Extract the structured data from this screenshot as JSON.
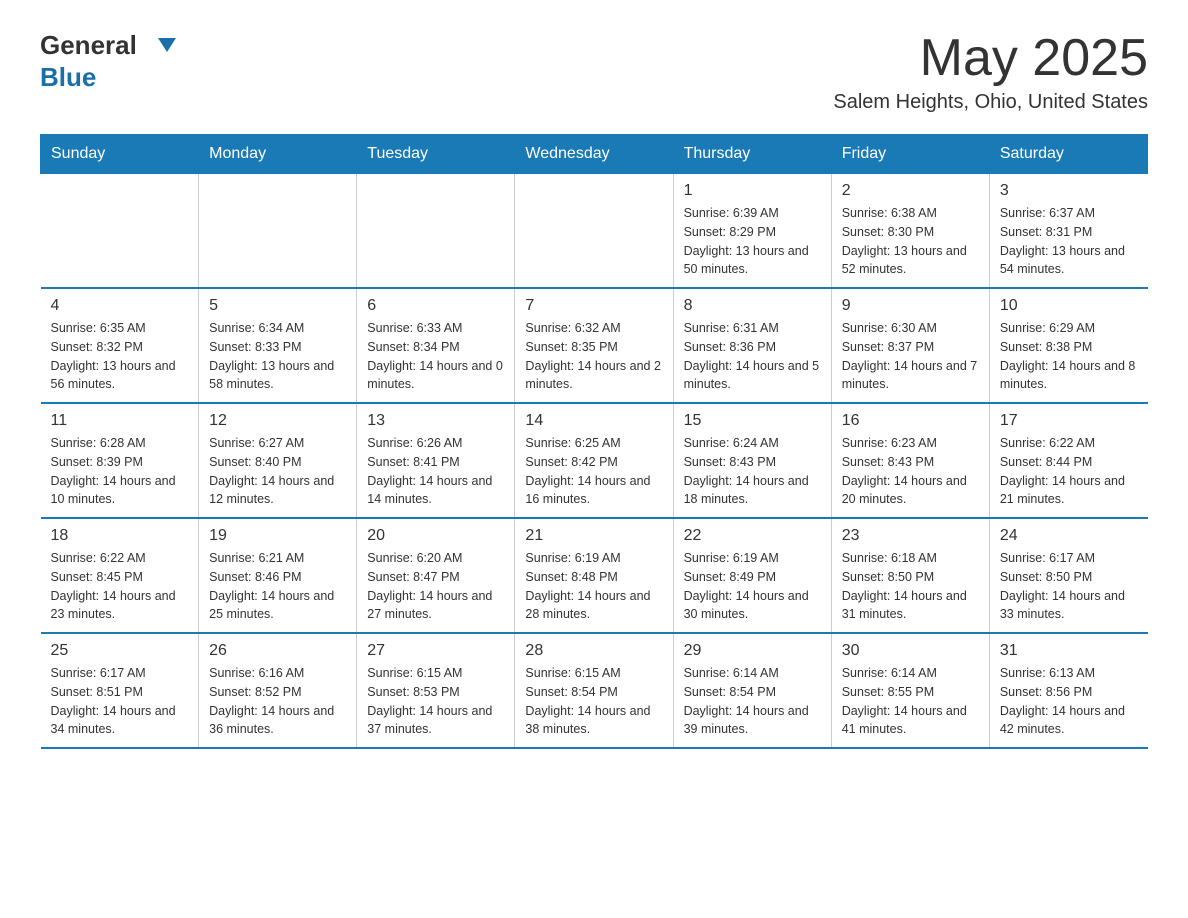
{
  "header": {
    "logo_general": "General",
    "logo_blue": "Blue",
    "month_title": "May 2025",
    "location": "Salem Heights, Ohio, United States"
  },
  "weekdays": [
    "Sunday",
    "Monday",
    "Tuesday",
    "Wednesday",
    "Thursday",
    "Friday",
    "Saturday"
  ],
  "weeks": [
    [
      {
        "day": "",
        "info": ""
      },
      {
        "day": "",
        "info": ""
      },
      {
        "day": "",
        "info": ""
      },
      {
        "day": "",
        "info": ""
      },
      {
        "day": "1",
        "info": "Sunrise: 6:39 AM\nSunset: 8:29 PM\nDaylight: 13 hours and 50 minutes."
      },
      {
        "day": "2",
        "info": "Sunrise: 6:38 AM\nSunset: 8:30 PM\nDaylight: 13 hours and 52 minutes."
      },
      {
        "day": "3",
        "info": "Sunrise: 6:37 AM\nSunset: 8:31 PM\nDaylight: 13 hours and 54 minutes."
      }
    ],
    [
      {
        "day": "4",
        "info": "Sunrise: 6:35 AM\nSunset: 8:32 PM\nDaylight: 13 hours and 56 minutes."
      },
      {
        "day": "5",
        "info": "Sunrise: 6:34 AM\nSunset: 8:33 PM\nDaylight: 13 hours and 58 minutes."
      },
      {
        "day": "6",
        "info": "Sunrise: 6:33 AM\nSunset: 8:34 PM\nDaylight: 14 hours and 0 minutes."
      },
      {
        "day": "7",
        "info": "Sunrise: 6:32 AM\nSunset: 8:35 PM\nDaylight: 14 hours and 2 minutes."
      },
      {
        "day": "8",
        "info": "Sunrise: 6:31 AM\nSunset: 8:36 PM\nDaylight: 14 hours and 5 minutes."
      },
      {
        "day": "9",
        "info": "Sunrise: 6:30 AM\nSunset: 8:37 PM\nDaylight: 14 hours and 7 minutes."
      },
      {
        "day": "10",
        "info": "Sunrise: 6:29 AM\nSunset: 8:38 PM\nDaylight: 14 hours and 8 minutes."
      }
    ],
    [
      {
        "day": "11",
        "info": "Sunrise: 6:28 AM\nSunset: 8:39 PM\nDaylight: 14 hours and 10 minutes."
      },
      {
        "day": "12",
        "info": "Sunrise: 6:27 AM\nSunset: 8:40 PM\nDaylight: 14 hours and 12 minutes."
      },
      {
        "day": "13",
        "info": "Sunrise: 6:26 AM\nSunset: 8:41 PM\nDaylight: 14 hours and 14 minutes."
      },
      {
        "day": "14",
        "info": "Sunrise: 6:25 AM\nSunset: 8:42 PM\nDaylight: 14 hours and 16 minutes."
      },
      {
        "day": "15",
        "info": "Sunrise: 6:24 AM\nSunset: 8:43 PM\nDaylight: 14 hours and 18 minutes."
      },
      {
        "day": "16",
        "info": "Sunrise: 6:23 AM\nSunset: 8:43 PM\nDaylight: 14 hours and 20 minutes."
      },
      {
        "day": "17",
        "info": "Sunrise: 6:22 AM\nSunset: 8:44 PM\nDaylight: 14 hours and 21 minutes."
      }
    ],
    [
      {
        "day": "18",
        "info": "Sunrise: 6:22 AM\nSunset: 8:45 PM\nDaylight: 14 hours and 23 minutes."
      },
      {
        "day": "19",
        "info": "Sunrise: 6:21 AM\nSunset: 8:46 PM\nDaylight: 14 hours and 25 minutes."
      },
      {
        "day": "20",
        "info": "Sunrise: 6:20 AM\nSunset: 8:47 PM\nDaylight: 14 hours and 27 minutes."
      },
      {
        "day": "21",
        "info": "Sunrise: 6:19 AM\nSunset: 8:48 PM\nDaylight: 14 hours and 28 minutes."
      },
      {
        "day": "22",
        "info": "Sunrise: 6:19 AM\nSunset: 8:49 PM\nDaylight: 14 hours and 30 minutes."
      },
      {
        "day": "23",
        "info": "Sunrise: 6:18 AM\nSunset: 8:50 PM\nDaylight: 14 hours and 31 minutes."
      },
      {
        "day": "24",
        "info": "Sunrise: 6:17 AM\nSunset: 8:50 PM\nDaylight: 14 hours and 33 minutes."
      }
    ],
    [
      {
        "day": "25",
        "info": "Sunrise: 6:17 AM\nSunset: 8:51 PM\nDaylight: 14 hours and 34 minutes."
      },
      {
        "day": "26",
        "info": "Sunrise: 6:16 AM\nSunset: 8:52 PM\nDaylight: 14 hours and 36 minutes."
      },
      {
        "day": "27",
        "info": "Sunrise: 6:15 AM\nSunset: 8:53 PM\nDaylight: 14 hours and 37 minutes."
      },
      {
        "day": "28",
        "info": "Sunrise: 6:15 AM\nSunset: 8:54 PM\nDaylight: 14 hours and 38 minutes."
      },
      {
        "day": "29",
        "info": "Sunrise: 6:14 AM\nSunset: 8:54 PM\nDaylight: 14 hours and 39 minutes."
      },
      {
        "day": "30",
        "info": "Sunrise: 6:14 AM\nSunset: 8:55 PM\nDaylight: 14 hours and 41 minutes."
      },
      {
        "day": "31",
        "info": "Sunrise: 6:13 AM\nSunset: 8:56 PM\nDaylight: 14 hours and 42 minutes."
      }
    ]
  ]
}
